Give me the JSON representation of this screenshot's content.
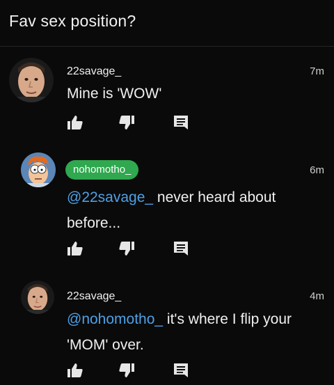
{
  "header": {
    "title": "Fav sex position?"
  },
  "comments": [
    {
      "username": "22savage_",
      "time": "7m",
      "mention": "",
      "text": "Mine is 'WOW'"
    },
    {
      "username": "nohomotho_",
      "time": "6m",
      "mention": "@22savage_",
      "text": " never heard about before..."
    },
    {
      "username": "22savage_",
      "time": "4m",
      "mention": "@nohomotho_",
      "text": " it's where I flip your 'MOM' over."
    }
  ],
  "icons": {
    "upvote": "thumbs-up-icon",
    "downvote": "thumbs-down-icon",
    "reply": "comment-icon"
  },
  "colors": {
    "background": "#0a0a0a",
    "mention": "#4ea0e6",
    "badge": "#2fa84f"
  }
}
